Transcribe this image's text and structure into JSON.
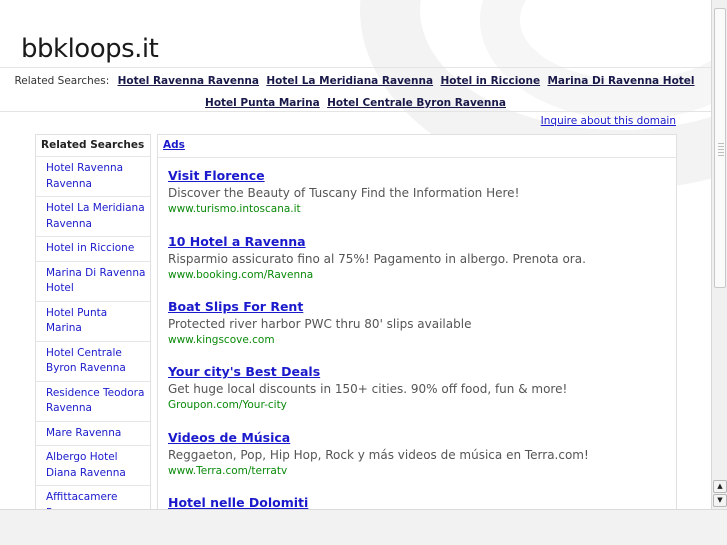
{
  "site": {
    "title": "bbkloops.it"
  },
  "related_bar": {
    "label": "Related Searches:",
    "links": [
      "Hotel Ravenna Ravenna",
      "Hotel La Meridiana Ravenna",
      "Hotel in Riccione",
      "Marina Di Ravenna Hotel",
      "Hotel Punta Marina",
      "Hotel Centrale Byron Ravenna"
    ]
  },
  "inquire_label": "Inquire about this domain",
  "sidebar": {
    "title": "Related Searches",
    "items": [
      "Hotel Ravenna Ravenna",
      "Hotel La Meridiana Ravenna",
      "Hotel in Riccione",
      "Marina Di Ravenna Hotel",
      "Hotel Punta Marina",
      "Hotel Centrale Byron Ravenna",
      "Residence Teodora Ravenna",
      "Mare Ravenna",
      "Albergo Hotel Diana Ravenna",
      "Affittacamere Ravenna"
    ]
  },
  "ads": {
    "header": "Ads",
    "items": [
      {
        "title": "Visit Florence",
        "desc": "Discover the Beauty of Tuscany Find the Information Here!",
        "url": "www.turismo.intoscana.it"
      },
      {
        "title": "10 Hotel a Ravenna",
        "desc": "Risparmio assicurato fino al 75%! Pagamento in albergo. Prenota ora.",
        "url": "www.booking.com/Ravenna"
      },
      {
        "title": "Boat Slips For Rent",
        "desc": "Protected river harbor PWC thru 80' slips available",
        "url": "www.kingscove.com"
      },
      {
        "title": "Your city's Best Deals",
        "desc": "Get huge local discounts in 150+ cities. 90% off food, fun & more!",
        "url": "Groupon.com/Your-city"
      },
      {
        "title": "Videos de Música",
        "desc": "Reggaeton, Pop, Hip Hop, Rock y más videos de música en Terra.com!",
        "url": "www.Terra.com/terratv"
      },
      {
        "title": "Hotel nelle Dolomiti",
        "desc": "",
        "url": ""
      }
    ]
  },
  "icons": {
    "scroll_up": "arrow-up-icon",
    "scroll_down": "arrow-down-icon"
  }
}
